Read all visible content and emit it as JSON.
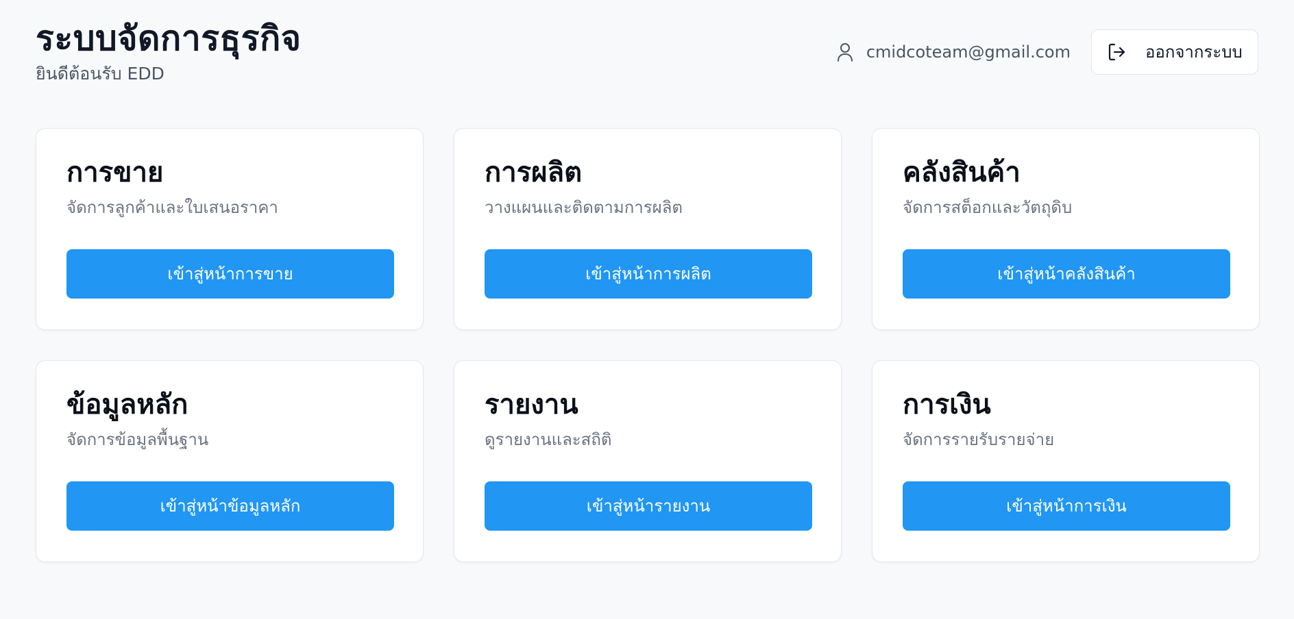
{
  "header": {
    "title": "ระบบจัดการธุรกิจ",
    "subtitle": "ยินดีต้อนรับ EDD",
    "user_email": "cmidcoteam@gmail.com",
    "user_icon": "user-icon",
    "logout_label": "ออกจากระบบ",
    "logout_icon": "logout-icon"
  },
  "theme": {
    "background": "#f8f9fb",
    "accent": "#2196f3",
    "card_background": "#ffffff"
  },
  "cards": [
    {
      "title": "การขาย",
      "description": "จัดการลูกค้าและใบเสนอราคา",
      "button": "เข้าสู่หน้าการขาย"
    },
    {
      "title": "การผลิต",
      "description": "วางแผนและติดตามการผลิต",
      "button": "เข้าสู่หน้าการผลิต"
    },
    {
      "title": "คลังสินค้า",
      "description": "จัดการสต็อกและวัตถุดิบ",
      "button": "เข้าสู่หน้าคลังสินค้า"
    },
    {
      "title": "ข้อมูลหลัก",
      "description": "จัดการข้อมูลพื้นฐาน",
      "button": "เข้าสู่หน้าข้อมูลหลัก"
    },
    {
      "title": "รายงาน",
      "description": "ดูรายงานและสถิติ",
      "button": "เข้าสู่หน้ารายงาน"
    },
    {
      "title": "การเงิน",
      "description": "จัดการรายรับรายจ่าย",
      "button": "เข้าสู่หน้าการเงิน"
    }
  ]
}
